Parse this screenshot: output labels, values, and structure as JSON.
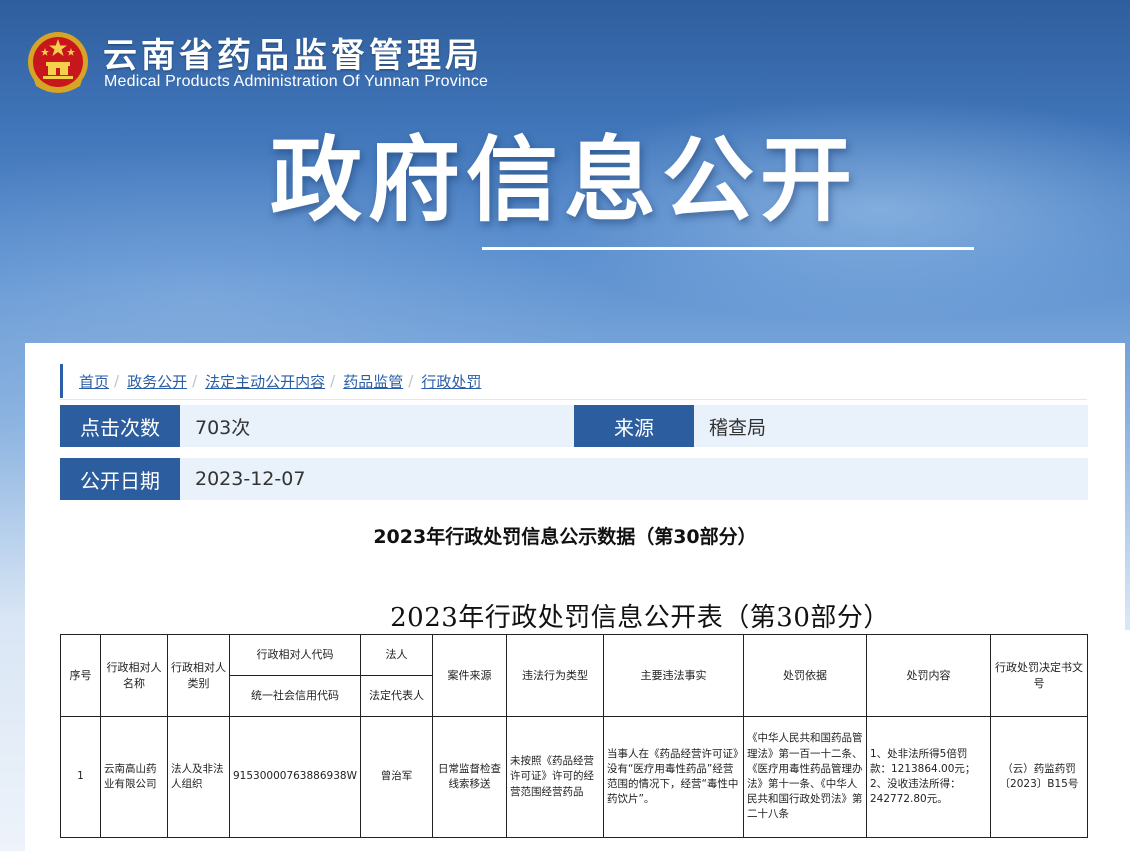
{
  "header": {
    "site_name_cn": "云南省药品监督管理局",
    "site_name_en": "Medical Products Administration Of Yunnan Province",
    "emblem_icon": "national-emblem-icon",
    "hero_title": "政府信息公开"
  },
  "breadcrumb": [
    {
      "label": "首页"
    },
    {
      "label": "政务公开"
    },
    {
      "label": "法定主动公开内容"
    },
    {
      "label": "药品监管"
    },
    {
      "label": "行政处罚"
    }
  ],
  "breadcrumb_separator": "/",
  "meta": {
    "clicks_label": "点击次数",
    "clicks_value": "703次",
    "source_label": "来源",
    "source_value": "稽查局",
    "date_label": "公开日期",
    "date_value": "2023-12-07"
  },
  "article": {
    "title": "2023年行政处罚信息公示数据（第30部分）",
    "table_title": "2023年行政处罚信息公开表（第30部分）"
  },
  "table": {
    "headers": {
      "seq": "序号",
      "name": "行政相对人名称",
      "category": "行政相对人类别",
      "code": "行政相对人代码",
      "code_sub": "统一社会信用代码",
      "legal": "法人",
      "legal_sub": "法定代表人",
      "source": "案件来源",
      "violation_type": "违法行为类型",
      "facts": "主要违法事实",
      "basis": "处罚依据",
      "content": "处罚内容",
      "doc_no": "行政处罚决定书文号"
    },
    "rows": [
      {
        "seq": "1",
        "name": "云南高山药业有限公司",
        "category": "法人及非法人组织",
        "code": "91530000763886938W",
        "legal": "曾治军",
        "source": "日常监督检查线索移送",
        "violation_type": "未按照《药品经营许可证》许可的经营范围经营药品",
        "facts": "当事人在《药品经营许可证》没有“医疗用毒性药品”经营范围的情况下，经营“毒性中药饮片”。",
        "basis": "《中华人民共和国药品管理法》第一百一十二条、《医疗用毒性药品管理办法》第十一条、《中华人民共和国行政处罚法》第二十八条",
        "content": "1、处非法所得5倍罚款：1213864.00元；2、没收违法所得：242772.80元。",
        "doc_no": "（云）药监药罚〔2023〕B15号"
      }
    ]
  }
}
